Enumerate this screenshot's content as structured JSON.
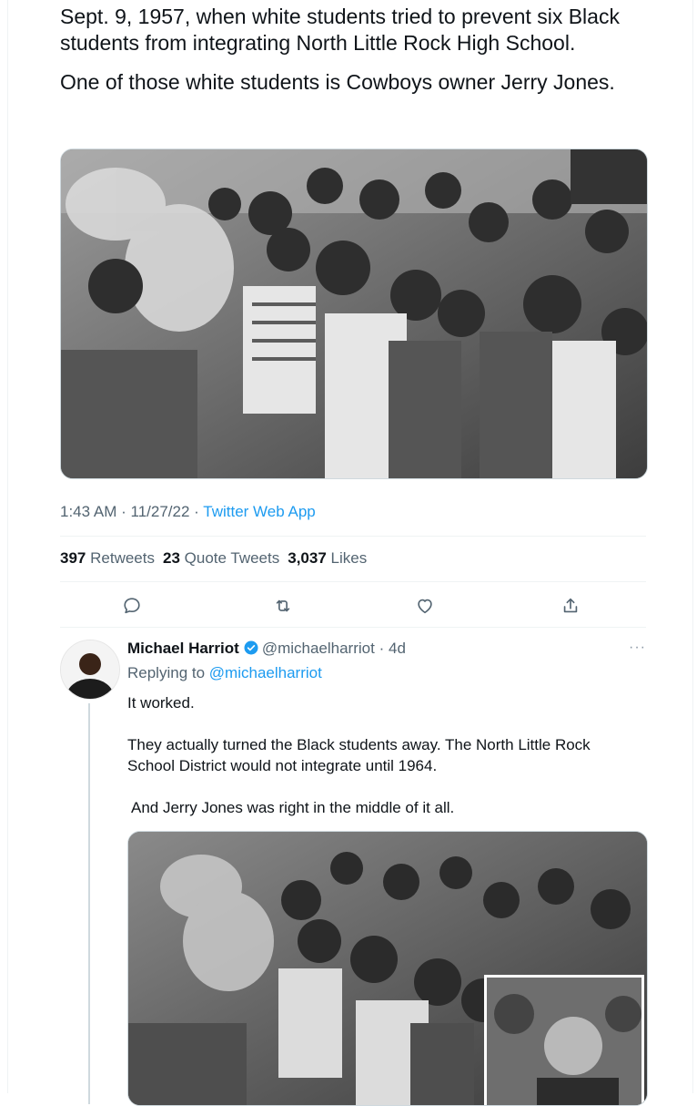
{
  "tweet": {
    "paragraphs": [
      "Sept. 9, 1957, when white students tried to prevent six Black students from integrating North Little Rock High School.",
      "One of those white students is Cowboys owner Jerry Jones."
    ],
    "time": "1:43 AM",
    "date": "11/27/22",
    "source": "Twitter Web App",
    "separator": "·",
    "stats": [
      {
        "count": "397",
        "label": "Retweets"
      },
      {
        "count": "23",
        "label": "Quote Tweets"
      },
      {
        "count": "3,037",
        "label": "Likes"
      }
    ],
    "actions": [
      {
        "icon": "reply-icon"
      },
      {
        "icon": "retweet-icon"
      },
      {
        "icon": "like-icon"
      },
      {
        "icon": "share-icon"
      }
    ]
  },
  "reply": {
    "name": "Michael Harriot",
    "handle": "@michaelharriot",
    "age": "4d",
    "replying_prefix": "Replying to",
    "replying_to": "@michaelharriot",
    "more": "···",
    "paragraphs": [
      "It worked.",
      "They actually turned the Black students away. The North Little Rock School District would not integrate until 1964.",
      " And Jerry Jones was right in the middle of it all."
    ]
  },
  "colors": {
    "text": "#0f1419",
    "secondary": "#536471",
    "link": "#1d9bf0",
    "divider": "#eff3f4"
  }
}
